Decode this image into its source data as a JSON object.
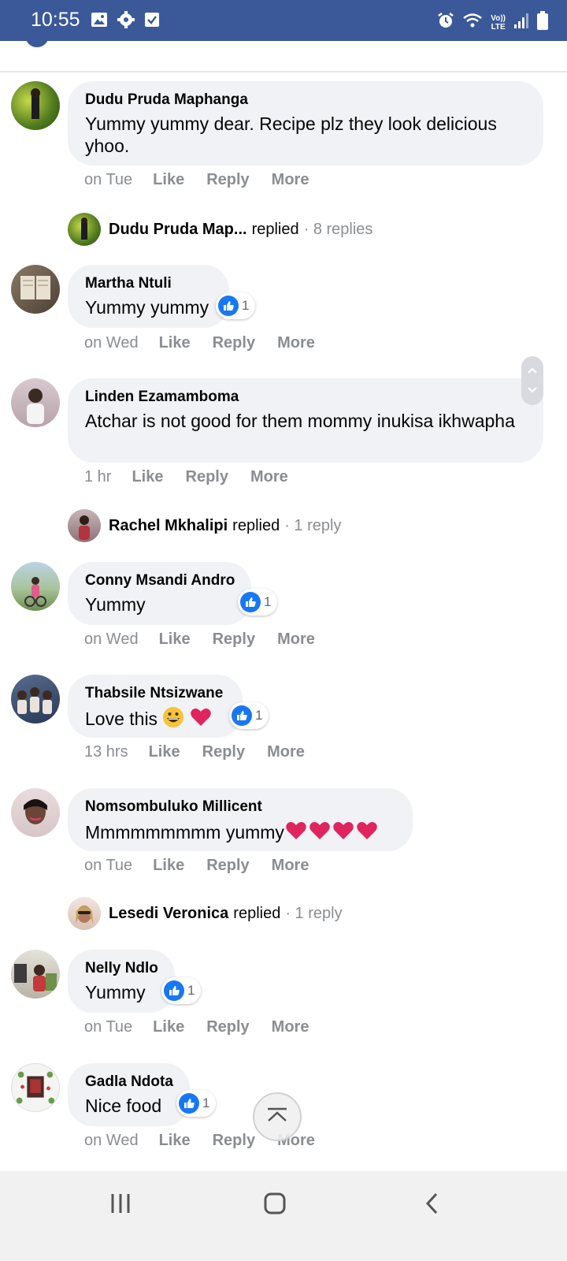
{
  "status_bar": {
    "time": "10:55",
    "left_icons": [
      "image-icon",
      "gear-icon",
      "checkbox-icon"
    ],
    "lte_label_top": "Vo))",
    "lte_label_bottom": "LTE",
    "right_icons": [
      "alarm-icon",
      "wifi-icon",
      "volte-icon",
      "signal-icon",
      "battery-icon"
    ],
    "bg_color": "#3b5998"
  },
  "comments": [
    {
      "name": "Dudu Pruda Maphanga",
      "text": "Yummy yummy dear. Recipe plz they look delicious yhoo.",
      "time": "on Tue",
      "like": "Like",
      "reply": "Reply",
      "more": "More"
    },
    {
      "name": "Martha Ntuli",
      "text": "Yummy yummy",
      "time": "on Wed",
      "like": "Like",
      "reply": "Reply",
      "more": "More",
      "likes": "1"
    },
    {
      "name": "Linden Ezamamboma",
      "text": "Atchar is not good for them mommy inukisa ikhwapha",
      "time": "1 hr",
      "like": "Like",
      "reply": "Reply",
      "more": "More"
    },
    {
      "name": "Conny Msandi Andro",
      "text": "Yummy",
      "time": "on Wed",
      "like": "Like",
      "reply": "Reply",
      "more": "More",
      "likes": "1"
    },
    {
      "name": "Thabsile Ntsizwane",
      "text": "Love this",
      "time": "13 hrs",
      "like": "Like",
      "reply": "Reply",
      "more": "More",
      "likes": "1"
    },
    {
      "name": "Nomsombuluko Millicent",
      "text": "Mmmmmmmmm yummy",
      "time": "on Tue",
      "like": "Like",
      "reply": "Reply",
      "more": "More"
    },
    {
      "name": "Nelly Ndlo",
      "text": "Yummy",
      "time": "on Tue",
      "like": "Like",
      "reply": "Reply",
      "more": "More",
      "likes": "1"
    },
    {
      "name": "Gadla Ndota",
      "text": "Nice food",
      "time": "on Wed",
      "like": "Like",
      "reply": "Reply",
      "more": "More",
      "likes": "1"
    }
  ],
  "reply_summaries": [
    {
      "name": "Dudu Pruda Map...",
      "verb": "replied",
      "count": "· 8 replies"
    },
    {
      "name": "Rachel Mkhalipi",
      "verb": "replied",
      "count": "· 1 reply"
    },
    {
      "name": "Lesedi Veronica",
      "verb": "replied",
      "count": "· 1 reply"
    }
  ],
  "colors": {
    "bubble": "#f0f2f5",
    "meta_text": "#8a8d91",
    "like_blue": "#1877f2",
    "heart_red": "#e0245e"
  }
}
